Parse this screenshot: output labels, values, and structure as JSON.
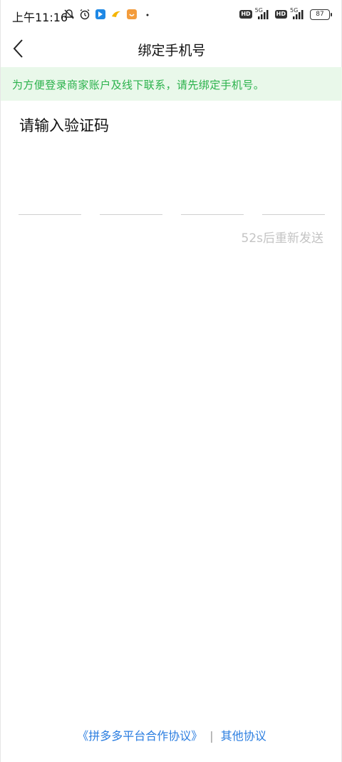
{
  "status_bar": {
    "time": "上午11:16",
    "network_1": "5G",
    "network_2": "5G",
    "hd_1": "HD",
    "hd_2": "HD",
    "battery": "87",
    "icons": [
      "bell-off-icon",
      "alarm-icon",
      "app-blue-icon",
      "app-yellow-icon",
      "app-orange-icon",
      "dot-icon"
    ]
  },
  "header": {
    "title": "绑定手机号",
    "back_icon": "chevron-left-icon"
  },
  "notice": {
    "text": "为方便登录商家账户及线下联系，请先绑定手机号。",
    "text_color": "#2bb24c",
    "background": "#e9f8ea"
  },
  "verification": {
    "prompt": "请输入验证码",
    "digits": [
      "",
      "",
      "",
      ""
    ],
    "resend_text": "52s后重新发送"
  },
  "footer": {
    "agreement_link": "《拼多多平台合作协议》",
    "separator": "|",
    "other_link": "其他协议",
    "link_color": "#2a7de0"
  }
}
